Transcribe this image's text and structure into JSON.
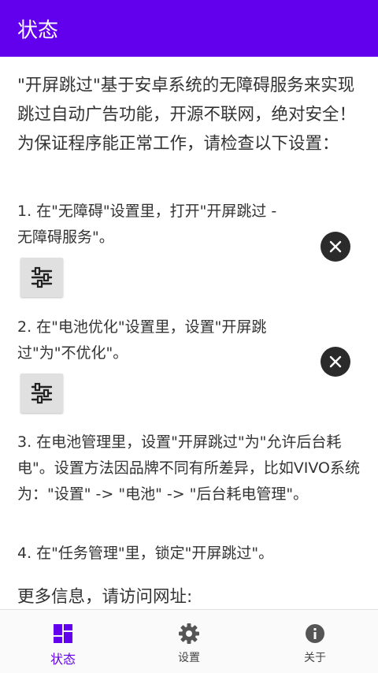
{
  "appbar": {
    "title": "状态"
  },
  "intro": "\"开屏跳过\"基于安卓系统的无障碍服务来实现跳过自动广告功能，开源不联网，绝对安全！为保证程序能正常工作，请检查以下设置：",
  "steps": [
    {
      "text": "1. 在\"无障碍\"设置里，打开\"开屏跳过 - 无障碍服务\"。"
    },
    {
      "text": "2. 在\"电池优化\"设置里，设置\"开屏跳过\"为\"不优化\"。"
    },
    {
      "text": "3. 在电池管理里，设置\"开屏跳过\"为\"允许后台耗电\"。设置方法因品牌不同有所差异，比如VIVO系统为：\"设置\" -> \"电池\" -> \"后台耗电管理\"。"
    },
    {
      "text": "4. 在\"任务管理\"里，锁定\"开屏跳过\"。"
    }
  ],
  "more_info": "更多信息，请访问网址:",
  "nav": [
    {
      "label": "状态",
      "icon": "dashboard-icon",
      "active": true
    },
    {
      "label": "设置",
      "icon": "gear-icon",
      "active": false
    },
    {
      "label": "关于",
      "icon": "info-icon",
      "active": false
    }
  ],
  "colors": {
    "primary": "#6200ee",
    "close_bg": "#2b2b2b",
    "button_bg": "#e0e0e0"
  }
}
